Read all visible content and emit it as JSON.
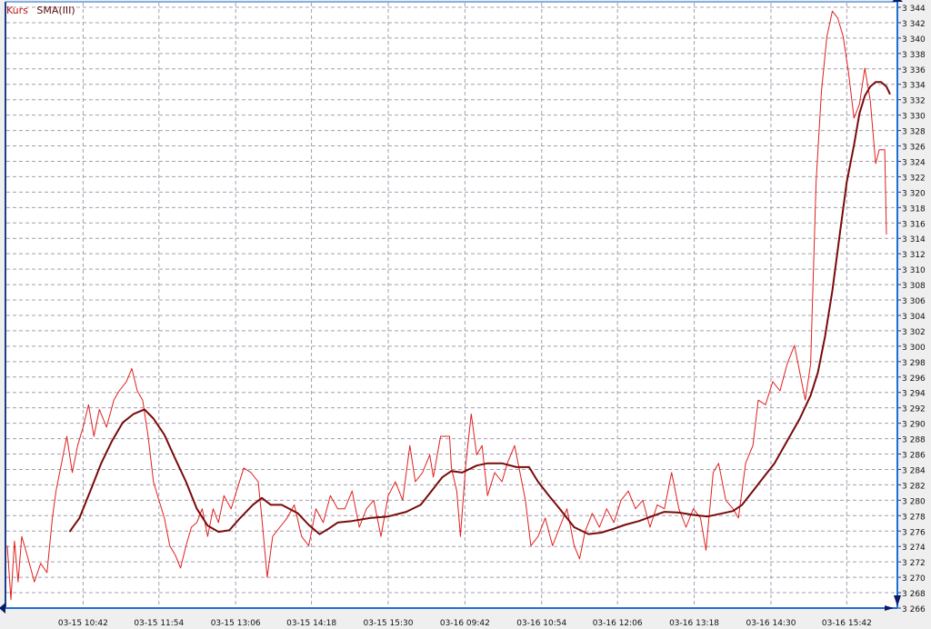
{
  "chart_data": {
    "type": "line",
    "title": "",
    "legend": [
      "Kurs",
      "SMA(III)"
    ],
    "legend_placement": "top-left",
    "colors": {
      "Kurs": "#e02020",
      "SMA(III)": "#7a0a0a",
      "frame": "#1c3c8c",
      "grid": "#a0a0b0"
    },
    "ylim": [
      3266,
      3344
    ],
    "y_ticks": [
      3266,
      3268,
      3270,
      3272,
      3274,
      3276,
      3278,
      3280,
      3282,
      3284,
      3286,
      3288,
      3290,
      3292,
      3294,
      3296,
      3298,
      3300,
      3302,
      3304,
      3306,
      3308,
      3310,
      3312,
      3314,
      3316,
      3318,
      3320,
      3322,
      3324,
      3326,
      3328,
      3330,
      3332,
      3334,
      3336,
      3338,
      3340,
      3342,
      3344
    ],
    "xlim": [
      0,
      980
    ],
    "x_ticks": [
      {
        "x": 85,
        "label": "03-15 10:42"
      },
      {
        "x": 169,
        "label": "03-15 11:54"
      },
      {
        "x": 254,
        "label": "03-15 13:06"
      },
      {
        "x": 338,
        "label": "03-15 14:18"
      },
      {
        "x": 423,
        "label": "03-15 15:30"
      },
      {
        "x": 508,
        "label": "03-16 09:42"
      },
      {
        "x": 593,
        "label": "03-16 10:54"
      },
      {
        "x": 677,
        "label": "03-16 12:06"
      },
      {
        "x": 762,
        "label": "03-16 13:18"
      },
      {
        "x": 847,
        "label": "03-16 14:30"
      },
      {
        "x": 931,
        "label": "03-16 15:42"
      }
    ],
    "grid": true,
    "series": [
      {
        "name": "Kurs",
        "points": [
          [
            1,
            3274.1
          ],
          [
            5,
            3267.1
          ],
          [
            9,
            3274.7
          ],
          [
            13,
            3269.4
          ],
          [
            17,
            3275.3
          ],
          [
            23,
            3272.9
          ],
          [
            31,
            3269.4
          ],
          [
            38,
            3271.8
          ],
          [
            45,
            3270.6
          ],
          [
            51,
            3277.7
          ],
          [
            55,
            3281.2
          ],
          [
            63,
            3285.9
          ],
          [
            67,
            3288.3
          ],
          [
            73,
            3283.6
          ],
          [
            79,
            3287.1
          ],
          [
            85,
            3289.5
          ],
          [
            91,
            3292.4
          ],
          [
            97,
            3288.3
          ],
          [
            103,
            3291.8
          ],
          [
            111,
            3289.5
          ],
          [
            119,
            3293.0
          ],
          [
            125,
            3294.2
          ],
          [
            133,
            3295.4
          ],
          [
            139,
            3297.1
          ],
          [
            145,
            3294.2
          ],
          [
            151,
            3293.0
          ],
          [
            157,
            3288.3
          ],
          [
            163,
            3282.4
          ],
          [
            169,
            3280.0
          ],
          [
            175,
            3277.7
          ],
          [
            181,
            3274.1
          ],
          [
            187,
            3272.9
          ],
          [
            193,
            3271.2
          ],
          [
            199,
            3274.1
          ],
          [
            205,
            3276.5
          ],
          [
            211,
            3277.1
          ],
          [
            217,
            3278.9
          ],
          [
            223,
            3275.3
          ],
          [
            229,
            3278.9
          ],
          [
            235,
            3277.1
          ],
          [
            241,
            3280.6
          ],
          [
            249,
            3278.9
          ],
          [
            255,
            3281.2
          ],
          [
            263,
            3284.2
          ],
          [
            271,
            3283.6
          ],
          [
            279,
            3282.4
          ],
          [
            283,
            3277.7
          ],
          [
            289,
            3270.0
          ],
          [
            295,
            3275.3
          ],
          [
            303,
            3276.5
          ],
          [
            311,
            3277.7
          ],
          [
            319,
            3279.4
          ],
          [
            327,
            3275.3
          ],
          [
            335,
            3274.1
          ],
          [
            343,
            3278.9
          ],
          [
            351,
            3277.1
          ],
          [
            359,
            3280.6
          ],
          [
            367,
            3278.9
          ],
          [
            375,
            3278.9
          ],
          [
            383,
            3281.2
          ],
          [
            391,
            3276.5
          ],
          [
            399,
            3278.9
          ],
          [
            407,
            3280.0
          ],
          [
            415,
            3275.3
          ],
          [
            423,
            3280.6
          ],
          [
            431,
            3282.4
          ],
          [
            439,
            3280.0
          ],
          [
            447,
            3287.1
          ],
          [
            453,
            3282.4
          ],
          [
            461,
            3283.6
          ],
          [
            469,
            3285.9
          ],
          [
            473,
            3283.0
          ],
          [
            481,
            3288.3
          ],
          [
            491,
            3288.3
          ],
          [
            493,
            3284.2
          ],
          [
            499,
            3281.2
          ],
          [
            503,
            3275.3
          ],
          [
            509,
            3284.8
          ],
          [
            515,
            3291.2
          ],
          [
            521,
            3285.9
          ],
          [
            527,
            3287.1
          ],
          [
            533,
            3280.6
          ],
          [
            541,
            3283.6
          ],
          [
            549,
            3282.4
          ],
          [
            555,
            3284.8
          ],
          [
            563,
            3287.1
          ],
          [
            569,
            3283.6
          ],
          [
            575,
            3280.0
          ],
          [
            581,
            3274.1
          ],
          [
            589,
            3275.3
          ],
          [
            597,
            3277.7
          ],
          [
            605,
            3274.1
          ],
          [
            613,
            3276.5
          ],
          [
            621,
            3278.9
          ],
          [
            629,
            3274.1
          ],
          [
            635,
            3272.4
          ],
          [
            641,
            3275.9
          ],
          [
            649,
            3278.3
          ],
          [
            657,
            3276.5
          ],
          [
            665,
            3278.9
          ],
          [
            673,
            3277.1
          ],
          [
            681,
            3280.0
          ],
          [
            689,
            3281.2
          ],
          [
            697,
            3278.9
          ],
          [
            705,
            3280.0
          ],
          [
            713,
            3276.5
          ],
          [
            721,
            3279.4
          ],
          [
            729,
            3278.9
          ],
          [
            737,
            3283.6
          ],
          [
            745,
            3278.9
          ],
          [
            753,
            3276.5
          ],
          [
            761,
            3278.9
          ],
          [
            769,
            3277.7
          ],
          [
            775,
            3273.5
          ],
          [
            783,
            3283.6
          ],
          [
            789,
            3284.8
          ],
          [
            797,
            3280.0
          ],
          [
            805,
            3278.9
          ],
          [
            811,
            3277.7
          ],
          [
            819,
            3284.8
          ],
          [
            827,
            3287.1
          ],
          [
            833,
            3293.0
          ],
          [
            841,
            3292.4
          ],
          [
            849,
            3295.4
          ],
          [
            857,
            3294.2
          ],
          [
            865,
            3297.7
          ],
          [
            873,
            3300.1
          ],
          [
            879,
            3296.6
          ],
          [
            885,
            3293.0
          ],
          [
            891,
            3297.7
          ],
          [
            897,
            3321.3
          ],
          [
            903,
            3333.1
          ],
          [
            909,
            3340.2
          ],
          [
            915,
            3343.5
          ],
          [
            921,
            3342.6
          ],
          [
            927,
            3340.2
          ],
          [
            933,
            3335.5
          ],
          [
            939,
            3329.6
          ],
          [
            945,
            3331.4
          ],
          [
            951,
            3336.1
          ],
          [
            957,
            3331.9
          ],
          [
            963,
            3323.7
          ],
          [
            967,
            3325.5
          ],
          [
            973,
            3325.5
          ],
          [
            975,
            3314.5
          ]
        ]
      },
      {
        "name": "SMA(III)",
        "points": [
          [
            70,
            3275.9
          ],
          [
            81,
            3277.7
          ],
          [
            93,
            3281.2
          ],
          [
            105,
            3284.8
          ],
          [
            117,
            3287.7
          ],
          [
            129,
            3290.1
          ],
          [
            141,
            3291.2
          ],
          [
            153,
            3291.8
          ],
          [
            163,
            3290.6
          ],
          [
            175,
            3288.5
          ],
          [
            187,
            3285.4
          ],
          [
            199,
            3282.4
          ],
          [
            211,
            3278.9
          ],
          [
            223,
            3276.7
          ],
          [
            235,
            3275.9
          ],
          [
            247,
            3276.1
          ],
          [
            259,
            3277.7
          ],
          [
            273,
            3279.4
          ],
          [
            283,
            3280.3
          ],
          [
            293,
            3279.4
          ],
          [
            305,
            3279.4
          ],
          [
            323,
            3278.3
          ],
          [
            335,
            3276.8
          ],
          [
            347,
            3275.6
          ],
          [
            357,
            3276.3
          ],
          [
            367,
            3277.1
          ],
          [
            383,
            3277.3
          ],
          [
            403,
            3277.7
          ],
          [
            423,
            3277.9
          ],
          [
            443,
            3278.5
          ],
          [
            459,
            3279.4
          ],
          [
            471,
            3281.2
          ],
          [
            483,
            3283.0
          ],
          [
            493,
            3283.8
          ],
          [
            505,
            3283.6
          ],
          [
            521,
            3284.5
          ],
          [
            533,
            3284.8
          ],
          [
            549,
            3284.8
          ],
          [
            565,
            3284.3
          ],
          [
            579,
            3284.3
          ],
          [
            589,
            3282.4
          ],
          [
            601,
            3280.6
          ],
          [
            613,
            3278.9
          ],
          [
            629,
            3276.5
          ],
          [
            645,
            3275.6
          ],
          [
            659,
            3275.8
          ],
          [
            673,
            3276.3
          ],
          [
            685,
            3276.8
          ],
          [
            701,
            3277.3
          ],
          [
            717,
            3278.0
          ],
          [
            729,
            3278.5
          ],
          [
            745,
            3278.4
          ],
          [
            761,
            3278.1
          ],
          [
            777,
            3277.9
          ],
          [
            793,
            3278.3
          ],
          [
            805,
            3278.6
          ],
          [
            815,
            3279.4
          ],
          [
            827,
            3281.2
          ],
          [
            839,
            3283.0
          ],
          [
            851,
            3284.8
          ],
          [
            865,
            3287.7
          ],
          [
            879,
            3290.6
          ],
          [
            891,
            3293.6
          ],
          [
            899,
            3296.6
          ],
          [
            907,
            3301.3
          ],
          [
            915,
            3307.2
          ],
          [
            923,
            3314.3
          ],
          [
            931,
            3321.3
          ],
          [
            939,
            3326.1
          ],
          [
            945,
            3330.2
          ],
          [
            951,
            3332.5
          ],
          [
            957,
            3333.7
          ],
          [
            963,
            3334.3
          ],
          [
            969,
            3334.3
          ],
          [
            975,
            3333.7
          ],
          [
            979,
            3332.7
          ]
        ]
      }
    ]
  }
}
